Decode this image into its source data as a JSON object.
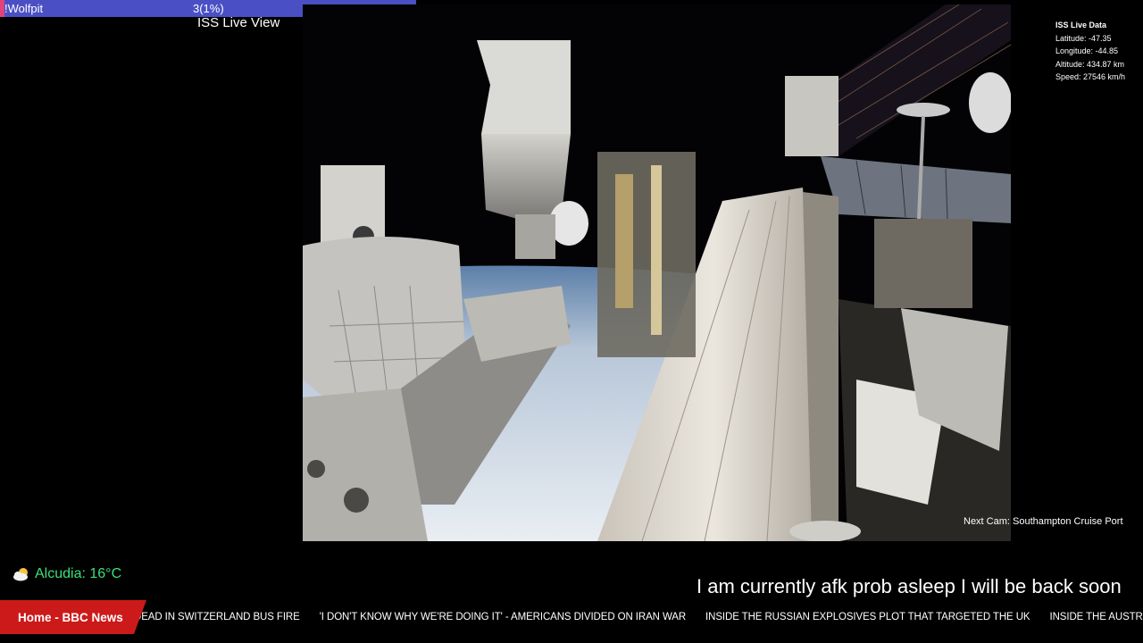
{
  "goal": {
    "name": "!Wolfpit",
    "progress_text": "3(1%)",
    "target": "300",
    "progress_fraction": 0.01,
    "fill_color": "#e0447e",
    "bar_color": "#4a4fc4"
  },
  "view_title": "ISS Live View",
  "live_data": {
    "title": "ISS Live Data",
    "latitude": "Latitude: -47.35",
    "longitude": "Longitude: -44.85",
    "altitude": "Altitude: 434.87 km",
    "speed": "Speed: 27546 km/h"
  },
  "next_cam": "Next Cam: Southampton Cruise Port",
  "weather": {
    "icon": "partly-cloudy-icon",
    "text": "Alcudia: 16°C",
    "color": "#3be07a"
  },
  "afk_message": "I am  currently afk prob asleep I will be back soon",
  "ticker": {
    "label": "Home - BBC News",
    "label_color": "#cc1a1a",
    "items": [
      "DEAD IN SWITZERLAND BUS FIRE",
      "'I DON'T KNOW WHY WE'RE DOING IT' - AMERICANS DIVIDED ON IRAN WAR",
      "INSIDE THE RUSSIAN EXPLOSIVES PLOT THAT TARGETED THE UK",
      "INSIDE THE AUSTRALIAN HOTEL WHERE IRA"
    ]
  }
}
